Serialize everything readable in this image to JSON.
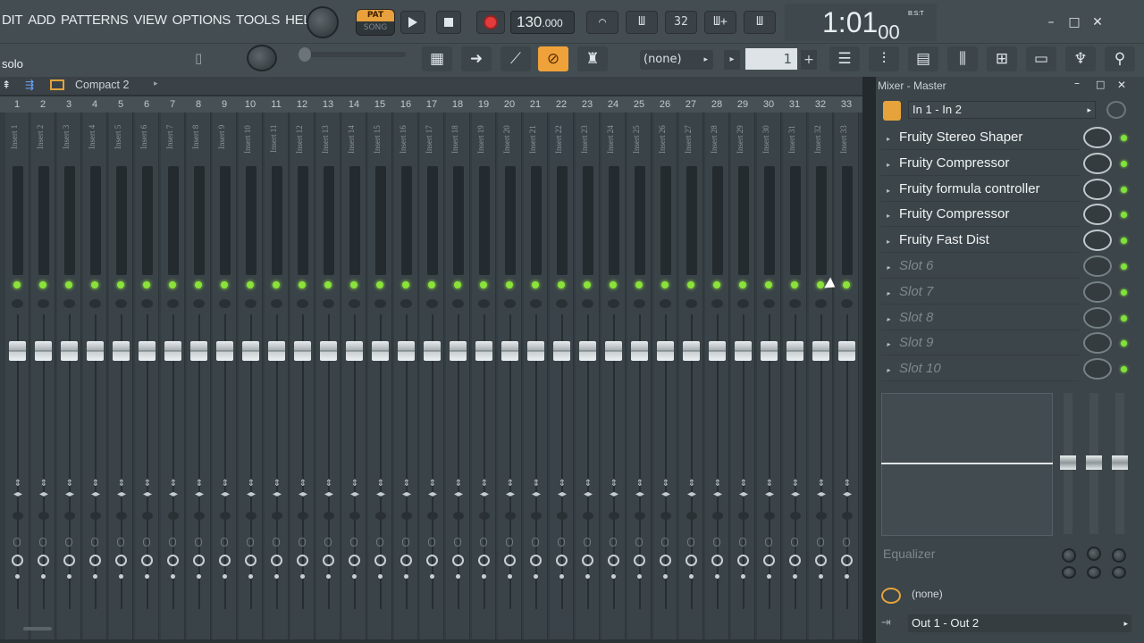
{
  "menu": [
    "DIT",
    "ADD",
    "PATTERNS",
    "VIEW",
    "OPTIONS",
    "TOOLS",
    "HELP"
  ],
  "transport": {
    "pat_label": "PAT",
    "song_label": "SONG",
    "tempo": "130",
    "tempo_decimal": ".000",
    "pattern_selector": "(none)",
    "pattern_number": "1"
  },
  "clock": {
    "bars": "1:01",
    "ticks": "00",
    "unit": "B:S:T"
  },
  "window_buttons": [
    "–",
    "□",
    "✕"
  ],
  "hint": "solo",
  "mixer": {
    "view_label": "Compact 2",
    "strip_count": 33,
    "insert_prefix": "Insert"
  },
  "channel_numbers": [
    "1",
    "2",
    "3",
    "4",
    "5",
    "6",
    "7",
    "8",
    "9",
    "10",
    "11",
    "12",
    "13",
    "14",
    "15",
    "16",
    "17",
    "18",
    "19",
    "20",
    "21",
    "22",
    "23",
    "24",
    "25",
    "26",
    "27",
    "28",
    "29",
    "30",
    "31",
    "32",
    "33"
  ],
  "right_panel": {
    "title": "Mixer - Master",
    "input": "In 1 - In 2",
    "slots": [
      {
        "label": "Fruity Stereo Shaper",
        "empty": false
      },
      {
        "label": "Fruity Compressor",
        "empty": false
      },
      {
        "label": "Fruity formula controller",
        "empty": false
      },
      {
        "label": "Fruity Compressor",
        "empty": false
      },
      {
        "label": "Fruity Fast Dist",
        "empty": false
      },
      {
        "label": "Slot 6",
        "empty": true
      },
      {
        "label": "Slot 7",
        "empty": true
      },
      {
        "label": "Slot 8",
        "empty": true
      },
      {
        "label": "Slot 9",
        "empty": true
      },
      {
        "label": "Slot 10",
        "empty": true
      }
    ],
    "eq_label": "Equalizer",
    "sidechain": "(none)",
    "output": "Out 1 - Out 2"
  },
  "colors": {
    "accent": "#f0a23a",
    "led": "#8be23a",
    "record": "#e33b3b"
  }
}
